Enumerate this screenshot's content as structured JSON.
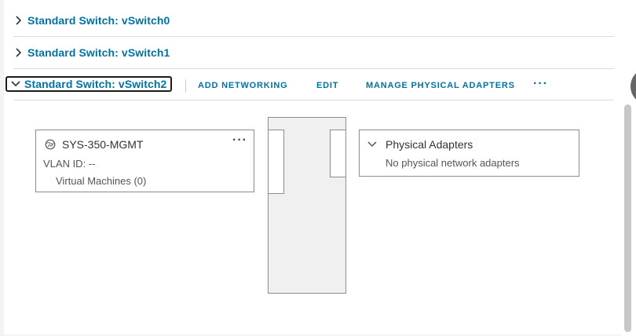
{
  "switches": [
    {
      "label": "Standard Switch: vSwitch0",
      "expanded": false
    },
    {
      "label": "Standard Switch: vSwitch1",
      "expanded": false
    },
    {
      "label": "Standard Switch: vSwitch2",
      "expanded": true
    }
  ],
  "toolbar": {
    "add_networking": "ADD NETWORKING",
    "edit": "EDIT",
    "manage_physical_adapters": "MANAGE PHYSICAL ADAPTERS",
    "more": "···"
  },
  "port_group": {
    "name": "SYS-350-MGMT",
    "vlan": "VLAN ID: --",
    "vms": "Virtual Machines (0)",
    "more": "···",
    "icon": "port-group-globe-icon"
  },
  "physical_adapters": {
    "title": "Physical Adapters",
    "empty": "No physical network adapters"
  },
  "colors": {
    "link": "#0072a3",
    "border": "#8c8c8c",
    "switch_fill": "#f0f0f0"
  }
}
